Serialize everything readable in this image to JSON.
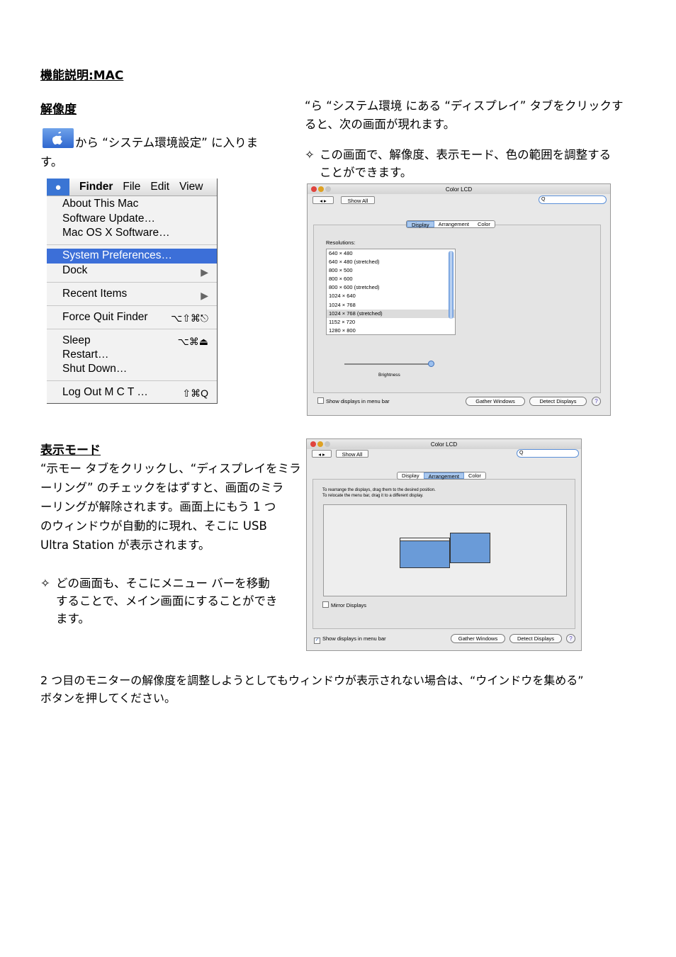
{
  "heading_main": "機能説明:MAC",
  "section1": {
    "title": "解像度",
    "intro_rest": "から “システム環境設定” に入りま",
    "intro_wrap": "す。",
    "right_p1_l1": "“ら “システム環境 にある “ディスプレイ” タブをクリックす",
    "right_p1_l2": "ると、次の画面が現れます。",
    "bullet": "✧",
    "right_p2_l1": "この画面で、解像度、表示モード、色の範囲を調整する",
    "right_p2_l2": "ことができます。"
  },
  "apple_menu": {
    "menubar": [
      "Finder",
      "File",
      "Edit",
      "View"
    ],
    "about": "About This Mac",
    "software_update": "Software Update…",
    "mac_os_software": "Mac OS X Software…",
    "system_preferences": "System Preferences…",
    "dock": "Dock",
    "recent_items": "Recent Items",
    "force_quit": "Force Quit Finder",
    "force_quit_shortcut": "⌥⇧⌘⎋",
    "sleep": "Sleep",
    "sleep_shortcut": "⌥⌘⏏",
    "restart": "Restart…",
    "shut_down": "Shut Down…",
    "log_out": "Log Out M C T …",
    "log_out_shortcut": "⇧⌘Q",
    "arrow": "▶"
  },
  "window1": {
    "title": "Color LCD",
    "show_all": "Show All",
    "search_glyph": "Q",
    "tabs": [
      "Display",
      "Arrangement",
      "Color"
    ],
    "resolutions_label": "Resolutions:",
    "resolutions": [
      "640 × 480",
      "640 × 480 (stretched)",
      "800 × 500",
      "800 × 600",
      "800 × 600 (stretched)",
      "1024 × 640",
      "1024 × 768",
      "1024 × 768 (stretched)",
      "1152 × 720",
      "1280 × 800"
    ],
    "brightness_label": "Brightness",
    "brightness_level": 1.0,
    "show_displays": "Show displays in menu bar",
    "gather_windows": "Gather Windows",
    "detect_displays": "Detect Displays",
    "help": "?"
  },
  "section2": {
    "title": "表示モード",
    "lines": [
      "“示モー タブをクリックし、“ディスプレイをミラ",
      "ーリング” のチェックをはずすと、画面のミラ",
      "ーリングが解除されます。画面上にもう 1 つ",
      "のウィンドウが自動的に現れ、そこに USB",
      "Ultra Station が表示されます。"
    ],
    "bullet": "✧",
    "bullet_lines": [
      "どの画面も、そこにメニュー バーを移動",
      "することで、メイン画面にすることができ",
      "ます。"
    ]
  },
  "window2": {
    "title": "Color LCD",
    "show_all": "Show All",
    "search_glyph": "Q",
    "tabs": [
      "Display",
      "Arrangement",
      "Color"
    ],
    "instruction1": "To rearrange the displays, drag them to the desired position.",
    "instruction2": "To relocate the menu bar, drag it to a different display.",
    "mirror_displays": "Mirror Displays",
    "show_displays": "Show displays in menu bar",
    "show_displays_check": "✓",
    "gather_windows": "Gather Windows",
    "detect_displays": "Detect Displays",
    "help": "?"
  },
  "footer": {
    "line1": "2 つ目のモニターの解像度を調整しようとしてもウィンドウが表示されない場合は、“ウインドウを集める”",
    "line2": "ボタンを押してください。"
  },
  "colors": {
    "accent_blue": "#3c6fd8",
    "display_blue": "#6a9bd8"
  }
}
